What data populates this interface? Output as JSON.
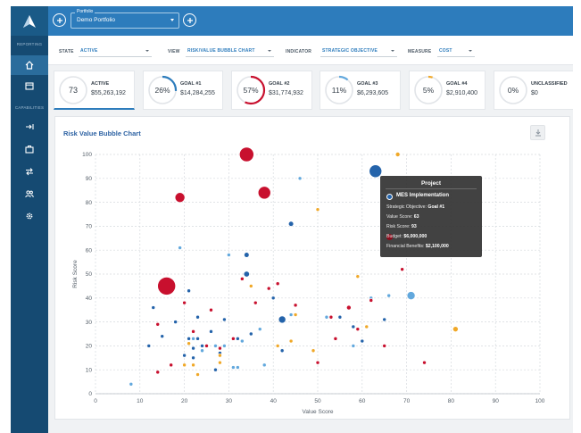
{
  "sidebar": {
    "sections": [
      "REPORTING",
      "CAPABILITIES"
    ],
    "items": [
      {
        "icon": "home-icon",
        "active": true
      },
      {
        "icon": "calendar-icon",
        "active": false
      },
      {
        "icon": "arrow-right-bar-icon",
        "active": false
      },
      {
        "icon": "briefcase-icon",
        "active": false
      },
      {
        "icon": "swap-icon",
        "active": false
      },
      {
        "icon": "users-icon",
        "active": false
      },
      {
        "icon": "gear-icon",
        "active": false
      }
    ]
  },
  "topbar": {
    "portfolio_caption": "Portfolio",
    "portfolio_value": "Demo Portfolio"
  },
  "filters": [
    {
      "label": "STATE",
      "value": "ACTIVE"
    },
    {
      "label": "VIEW",
      "value": "RISK/VALUE BUBBLE CHART"
    },
    {
      "label": "INDICATOR",
      "value": "STRATEGIC OBJECTIVE"
    },
    {
      "label": "MEASURE",
      "value": "COST"
    }
  ],
  "cards": [
    {
      "title": "ACTIVE",
      "amount": "$55,263,192",
      "gauge": "73",
      "gauge_pct": 0,
      "color": "#2d7cbc",
      "active": true
    },
    {
      "title": "GOAL #1",
      "amount": "$14,284,255",
      "gauge": "26%",
      "gauge_pct": 26,
      "color": "#2d7cbc",
      "active": false
    },
    {
      "title": "GOAL #2",
      "amount": "$31,774,932",
      "gauge": "57%",
      "gauge_pct": 57,
      "color": "#c8102e",
      "active": false
    },
    {
      "title": "GOAL #3",
      "amount": "$6,293,605",
      "gauge": "11%",
      "gauge_pct": 11,
      "color": "#62a8dd",
      "active": false
    },
    {
      "title": "GOAL #4",
      "amount": "$2,910,400",
      "gauge": "5%",
      "gauge_pct": 5,
      "color": "#f0a828",
      "active": false
    },
    {
      "title": "UNCLASSIFIED",
      "amount": "$0",
      "gauge": "0%",
      "gauge_pct": 0,
      "color": "#2d7cbc",
      "active": false
    }
  ],
  "chart_title": "Risk Value Bubble Chart",
  "chart_data": {
    "type": "scatter",
    "title": "Risk Value Bubble Chart",
    "xlabel": "Value Score",
    "ylabel": "Risk Score",
    "xlim": [
      0,
      100
    ],
    "ylim": [
      0,
      100
    ],
    "xticks": [
      0,
      10,
      20,
      30,
      40,
      50,
      60,
      70,
      80,
      90,
      100
    ],
    "yticks": [
      0,
      10,
      20,
      30,
      40,
      50,
      60,
      70,
      80,
      90,
      100
    ],
    "grid": true,
    "series": [
      {
        "color": "#2463aa",
        "points": [
          {
            "x": 63,
            "y": 93,
            "s": 7
          },
          {
            "x": 42,
            "y": 31,
            "s": 4
          },
          {
            "x": 34,
            "y": 50,
            "s": 3.2
          },
          {
            "x": 34,
            "y": 58,
            "s": 2.8
          },
          {
            "x": 44,
            "y": 71,
            "s": 2.8
          },
          {
            "x": 12,
            "y": 20,
            "s": 2
          },
          {
            "x": 13,
            "y": 36,
            "s": 2
          },
          {
            "x": 15,
            "y": 24,
            "s": 2
          },
          {
            "x": 18,
            "y": 30,
            "s": 2
          },
          {
            "x": 20,
            "y": 16,
            "s": 2
          },
          {
            "x": 21,
            "y": 43,
            "s": 2
          },
          {
            "x": 21,
            "y": 23,
            "s": 2
          },
          {
            "x": 22,
            "y": 19,
            "s": 2
          },
          {
            "x": 22,
            "y": 15,
            "s": 2
          },
          {
            "x": 23,
            "y": 32,
            "s": 2
          },
          {
            "x": 24,
            "y": 20,
            "s": 2
          },
          {
            "x": 25,
            "y": 20,
            "s": 2
          },
          {
            "x": 26,
            "y": 26,
            "s": 2
          },
          {
            "x": 27,
            "y": 10,
            "s": 2
          },
          {
            "x": 28,
            "y": 17,
            "s": 2
          },
          {
            "x": 29,
            "y": 31,
            "s": 2
          },
          {
            "x": 32,
            "y": 23,
            "s": 2
          },
          {
            "x": 35,
            "y": 25,
            "s": 2
          },
          {
            "x": 42,
            "y": 18,
            "s": 2
          },
          {
            "x": 55,
            "y": 32,
            "s": 2
          },
          {
            "x": 58,
            "y": 28,
            "s": 2
          },
          {
            "x": 60,
            "y": 22,
            "s": 2
          },
          {
            "x": 65,
            "y": 31,
            "s": 2
          },
          {
            "x": 23,
            "y": 23,
            "s": 2
          },
          {
            "x": 40,
            "y": 40,
            "s": 2
          }
        ]
      },
      {
        "color": "#62a8dd",
        "points": [
          {
            "x": 71,
            "y": 41,
            "s": 4.5
          },
          {
            "x": 8,
            "y": 4,
            "s": 2
          },
          {
            "x": 19,
            "y": 61,
            "s": 2
          },
          {
            "x": 22,
            "y": 23,
            "s": 2
          },
          {
            "x": 24,
            "y": 18,
            "s": 2
          },
          {
            "x": 27,
            "y": 20,
            "s": 2
          },
          {
            "x": 29,
            "y": 20,
            "s": 2
          },
          {
            "x": 30,
            "y": 58,
            "s": 2
          },
          {
            "x": 31,
            "y": 11,
            "s": 2
          },
          {
            "x": 32,
            "y": 11,
            "s": 2
          },
          {
            "x": 33,
            "y": 22,
            "s": 2
          },
          {
            "x": 37,
            "y": 27,
            "s": 2
          },
          {
            "x": 38,
            "y": 12,
            "s": 2
          },
          {
            "x": 46,
            "y": 90,
            "s": 2
          },
          {
            "x": 52,
            "y": 32,
            "s": 2
          },
          {
            "x": 58,
            "y": 20,
            "s": 2
          },
          {
            "x": 62,
            "y": 40,
            "s": 2
          },
          {
            "x": 66,
            "y": 41,
            "s": 2
          },
          {
            "x": 44,
            "y": 33,
            "s": 2
          }
        ]
      },
      {
        "color": "#c8102e",
        "points": [
          {
            "x": 16,
            "y": 45,
            "s": 10
          },
          {
            "x": 34,
            "y": 100,
            "s": 8
          },
          {
            "x": 38,
            "y": 84,
            "s": 7
          },
          {
            "x": 19,
            "y": 82,
            "s": 5.5
          },
          {
            "x": 57,
            "y": 36,
            "s": 2.5
          },
          {
            "x": 14,
            "y": 29,
            "s": 2
          },
          {
            "x": 14,
            "y": 9,
            "s": 2
          },
          {
            "x": 17,
            "y": 12,
            "s": 2
          },
          {
            "x": 20,
            "y": 38,
            "s": 2
          },
          {
            "x": 22,
            "y": 26,
            "s": 2
          },
          {
            "x": 25,
            "y": 20,
            "s": 2
          },
          {
            "x": 28,
            "y": 19,
            "s": 2
          },
          {
            "x": 31,
            "y": 23,
            "s": 2
          },
          {
            "x": 33,
            "y": 48,
            "s": 2
          },
          {
            "x": 36,
            "y": 38,
            "s": 2
          },
          {
            "x": 39,
            "y": 44,
            "s": 2
          },
          {
            "x": 41,
            "y": 46,
            "s": 2
          },
          {
            "x": 45,
            "y": 37,
            "s": 2
          },
          {
            "x": 50,
            "y": 13,
            "s": 2
          },
          {
            "x": 53,
            "y": 32,
            "s": 2
          },
          {
            "x": 54,
            "y": 23,
            "s": 2
          },
          {
            "x": 59,
            "y": 27,
            "s": 2
          },
          {
            "x": 62,
            "y": 39,
            "s": 2
          },
          {
            "x": 65,
            "y": 20,
            "s": 2
          },
          {
            "x": 69,
            "y": 52,
            "s": 2
          },
          {
            "x": 74,
            "y": 13,
            "s": 2
          },
          {
            "x": 26,
            "y": 35,
            "s": 2
          }
        ]
      },
      {
        "color": "#f0a828",
        "points": [
          {
            "x": 68,
            "y": 100,
            "s": 2.5
          },
          {
            "x": 81,
            "y": 27,
            "s": 3
          },
          {
            "x": 50,
            "y": 77,
            "s": 2
          },
          {
            "x": 59,
            "y": 49,
            "s": 2
          },
          {
            "x": 35,
            "y": 45,
            "s": 2
          },
          {
            "x": 22,
            "y": 12,
            "s": 2
          },
          {
            "x": 20,
            "y": 12,
            "s": 2
          },
          {
            "x": 21,
            "y": 21,
            "s": 2
          },
          {
            "x": 23,
            "y": 8,
            "s": 2
          },
          {
            "x": 28,
            "y": 13,
            "s": 2
          },
          {
            "x": 28,
            "y": 16,
            "s": 2
          },
          {
            "x": 41,
            "y": 20,
            "s": 2
          },
          {
            "x": 45,
            "y": 33,
            "s": 2
          },
          {
            "x": 44,
            "y": 22,
            "s": 2
          },
          {
            "x": 49,
            "y": 18,
            "s": 2
          },
          {
            "x": 61,
            "y": 28,
            "s": 2
          }
        ]
      }
    ]
  },
  "tooltip": {
    "heading": "Project",
    "name": "MES Implementation",
    "rows": [
      {
        "label": "Strategic Objective: ",
        "value": "Goal #1"
      },
      {
        "label": "Value Score: ",
        "value": "63"
      },
      {
        "label": "Risk Score: ",
        "value": "93"
      },
      {
        "label": "Budget: ",
        "value": "$6,000,000"
      },
      {
        "label": "Financial Benefits: ",
        "value": "$2,100,000"
      }
    ],
    "name_color": "#2463aa",
    "budget_color": "#8b0c1c"
  }
}
